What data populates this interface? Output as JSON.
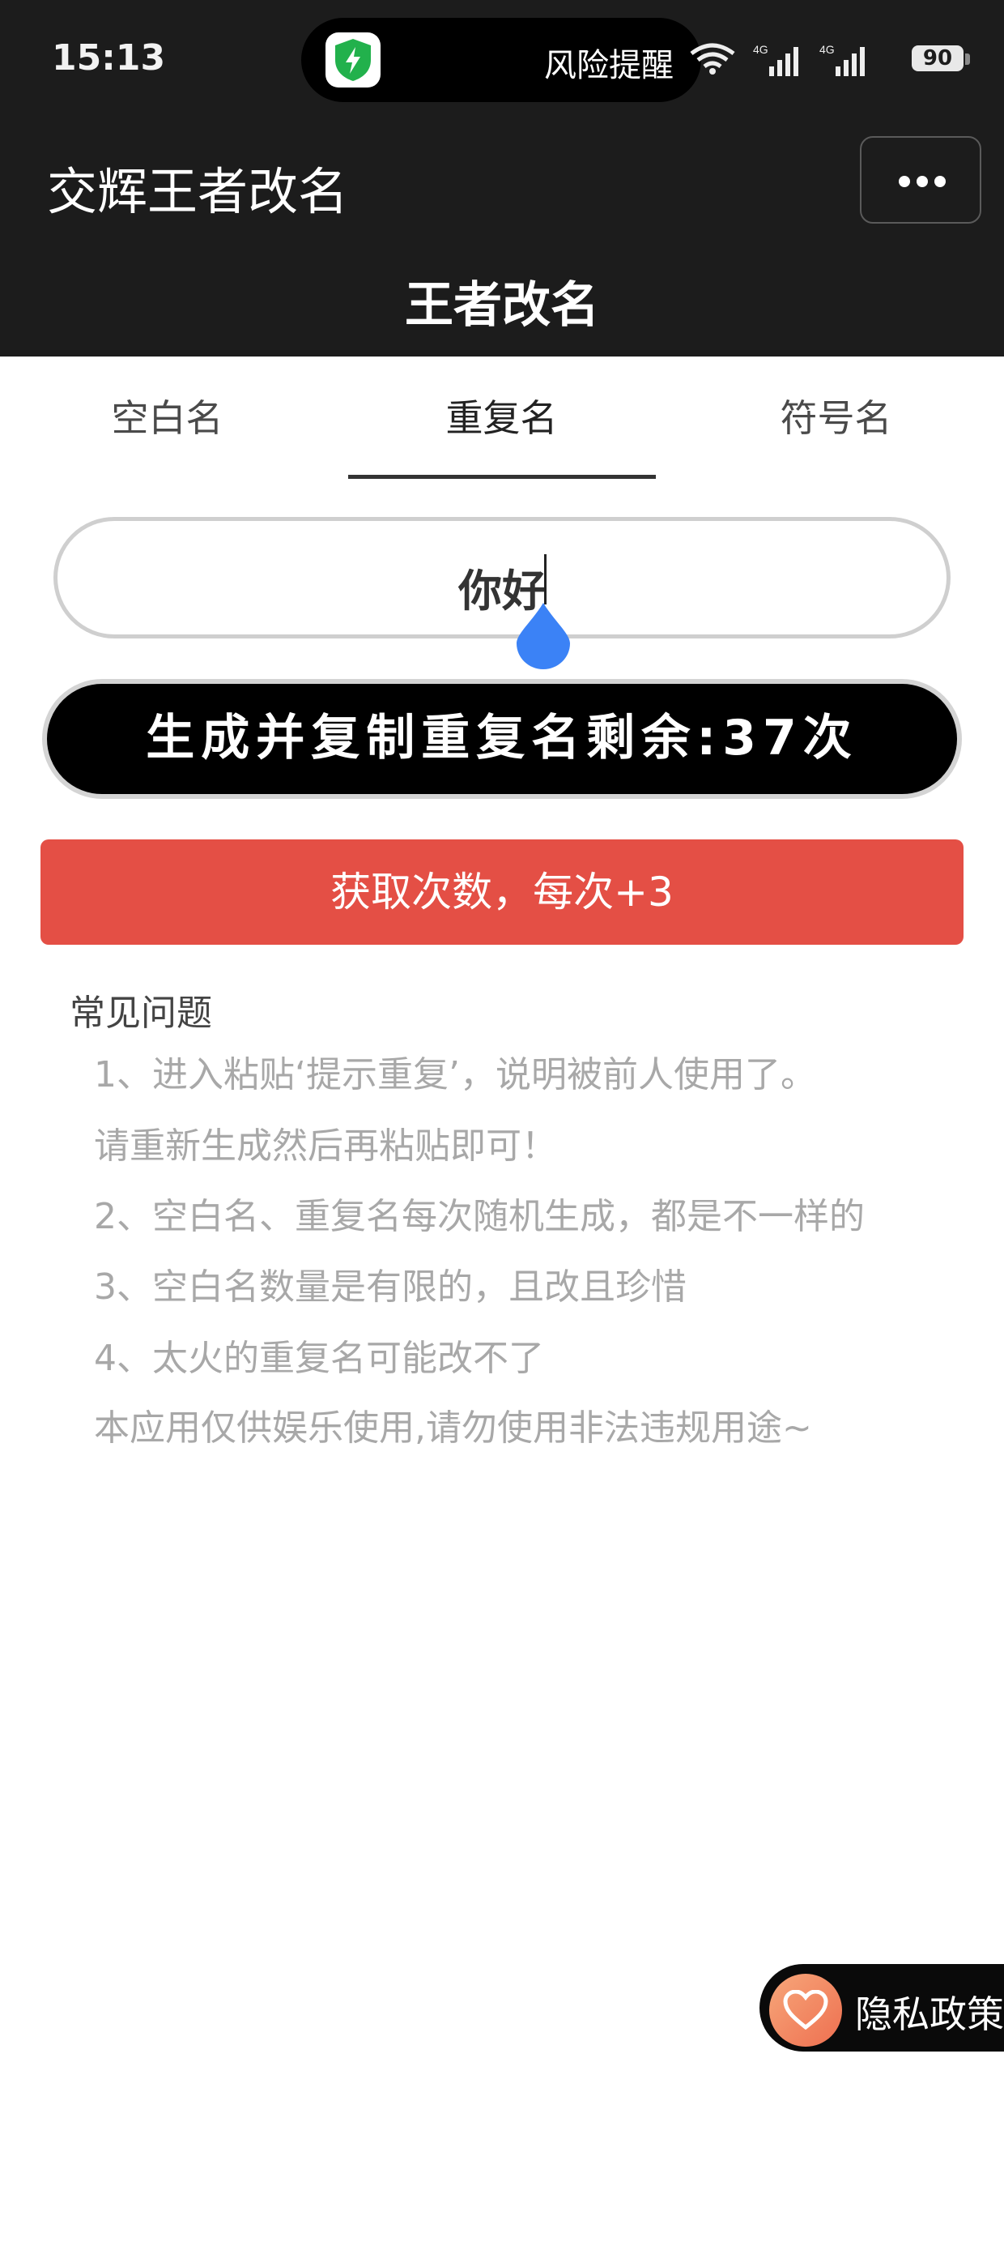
{
  "status_bar": {
    "time": "15:13",
    "island_text": "风险提醒",
    "island_icon": "shield-bolt-icon",
    "battery": "90",
    "network_label_1": "4G",
    "network_label_2": "4G"
  },
  "header": {
    "app_title": "交辉王者改名",
    "page_title": "王者改名",
    "more_icon": "more-horizontal-icon"
  },
  "tabs": [
    {
      "label": "空白名",
      "active": false
    },
    {
      "label": "重复名",
      "active": true
    },
    {
      "label": "符号名",
      "active": false
    }
  ],
  "name_input": {
    "value": "你好"
  },
  "generate_button": {
    "label": "生成并复制重复名剩余:37次"
  },
  "get_count_button": {
    "label": "获取次数，每次+3"
  },
  "faq": {
    "title": "常见问题",
    "items": [
      "1、进入粘贴‘提示重复’，说明被前人使用了。",
      "请重新生成然后再粘贴即可！",
      "2、空白名、重复名每次随机生成，都是不一样的",
      "3、空白名数量是有限的，且改且珍惜",
      "4、太火的重复名可能改不了",
      "本应用仅供娱乐使用,请勿使用非法违规用途~"
    ]
  },
  "privacy": {
    "label": "隐私政策",
    "icon": "heart-icon"
  },
  "colors": {
    "header_bg": "#1c1c1c",
    "accent_red": "#e44f45",
    "caret_handle_blue": "#3b82f6"
  }
}
